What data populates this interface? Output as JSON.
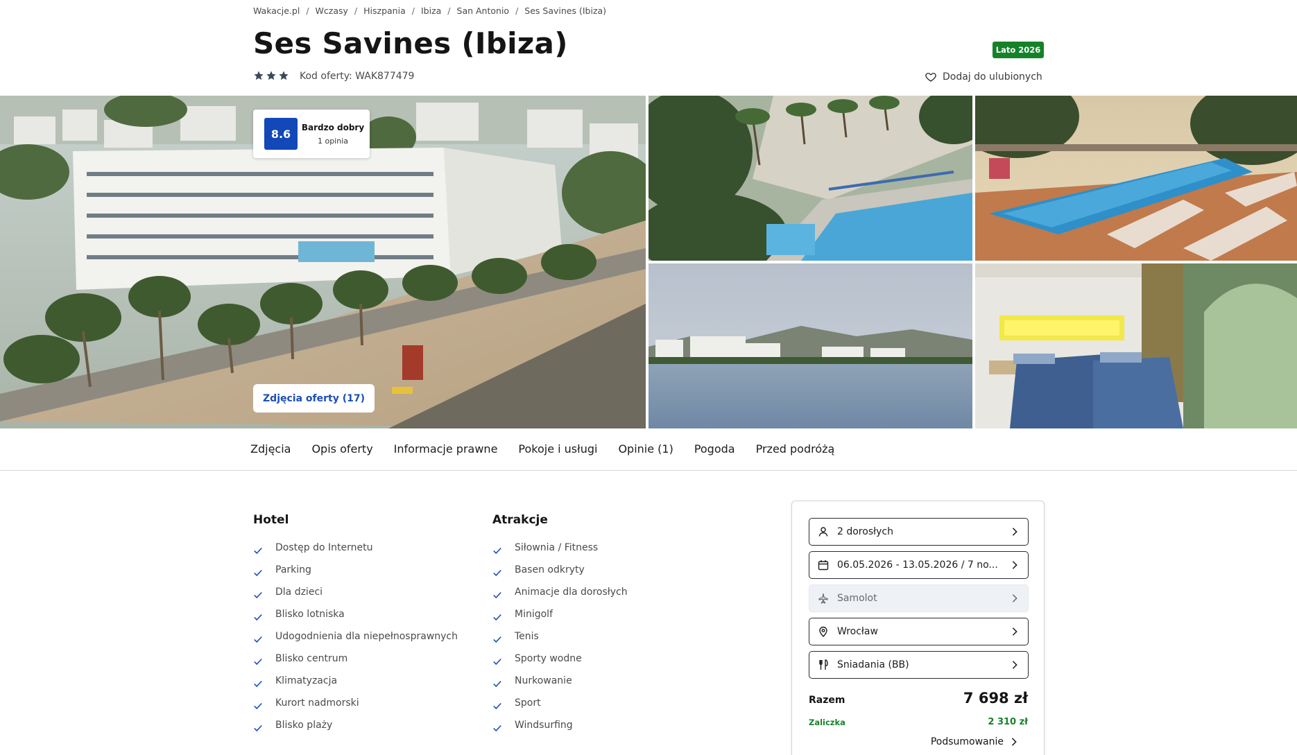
{
  "breadcrumb": [
    "Wakacje.pl",
    "Wczasy",
    "Hiszpania",
    "Ibiza",
    "San Antonio",
    "Ses Savines (Ibiza)"
  ],
  "header": {
    "title": "Ses Savines (Ibiza)",
    "stars": 3,
    "offer_code": "Kod oferty: WAK877479",
    "season_badge": "Lato 2026",
    "favorite_label": "Dodaj do ulubionych"
  },
  "gallery": {
    "rating_score": "8.6",
    "rating_label": "Bardzo dobry",
    "rating_count": "1 opinia",
    "photos_button": "Zdjęcia oferty (17)"
  },
  "tabs": [
    "Zdjęcia",
    "Opis oferty",
    "Informacje prawne",
    "Pokoje i usługi",
    "Opinie (1)",
    "Pogoda",
    "Przed podróżą"
  ],
  "hotel": {
    "title": "Hotel",
    "items": [
      "Dostęp do Internetu",
      "Parking",
      "Dla dzieci",
      "Blisko lotniska",
      "Udogodnienia dla niepełnosprawnych",
      "Blisko centrum",
      "Klimatyzacja",
      "Kurort nadmorski",
      "Blisko plaży"
    ]
  },
  "attractions": {
    "title": "Atrakcje",
    "items": [
      "Siłownia / Fitness",
      "Basen odkryty",
      "Animacje dla dorosłych",
      "Minigolf",
      "Tenis",
      "Sporty wodne",
      "Nurkowanie",
      "Sport",
      "Windsurfing"
    ]
  },
  "booking": {
    "travelers": "2 dorosłych",
    "dates": "06.05.2026 - 13.05.2026 / 7 no...",
    "transport": "Samolot",
    "departure": "Wrocław",
    "board": "Śniadania (BB)",
    "total_label": "Razem",
    "total_price": "7 698 zł",
    "deposit_label": "Zaliczka",
    "deposit_price": "2 310 zł",
    "summary_label": "Podsumowanie"
  },
  "colors": {
    "brand_blue": "#1248b8",
    "badge_green": "#15822a",
    "check_blue": "#1a4fb8"
  }
}
